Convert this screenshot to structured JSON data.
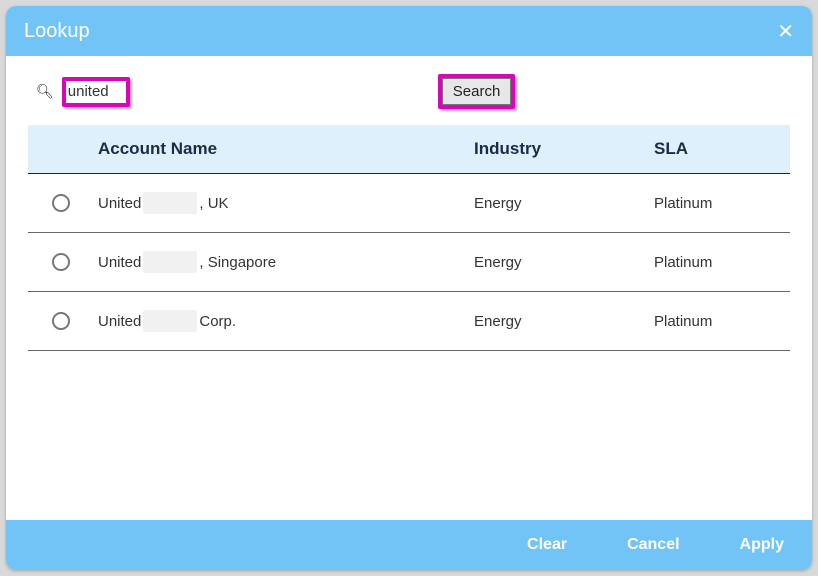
{
  "dialog": {
    "title": "Lookup",
    "close_glyph": "✕"
  },
  "search": {
    "icon": "🔍︎",
    "value": "united",
    "button": "Search"
  },
  "table": {
    "columns": {
      "name": "Account Name",
      "industry": "Industry",
      "sla": "SLA"
    },
    "rows": [
      {
        "name_pre": "United ",
        "name_post": ", UK",
        "industry": "Energy",
        "sla": "Platinum"
      },
      {
        "name_pre": "United ",
        "name_post": ", Singapore",
        "industry": "Energy",
        "sla": "Platinum"
      },
      {
        "name_pre": "United ",
        "name_post": " Corp.",
        "industry": "Energy",
        "sla": "Platinum"
      }
    ]
  },
  "footer": {
    "clear": "Clear",
    "cancel": "Cancel",
    "apply": "Apply"
  }
}
